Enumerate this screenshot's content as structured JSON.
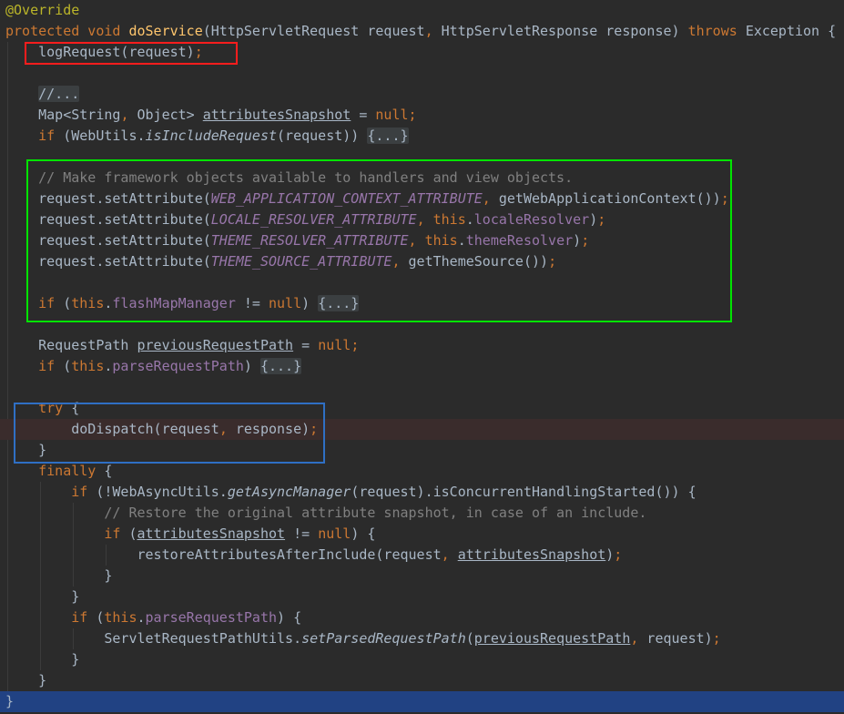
{
  "editor": {
    "lines": [
      {
        "tokens": [
          {
            "t": "@Override",
            "c": "ann"
          }
        ]
      },
      {
        "tokens": [
          {
            "t": "protected void ",
            "c": "kw"
          },
          {
            "t": "doService",
            "c": "fn"
          },
          {
            "t": "(HttpServletRequest request",
            "c": "plain"
          },
          {
            "t": ", ",
            "c": "kw"
          },
          {
            "t": "HttpServletResponse response) ",
            "c": "plain"
          },
          {
            "t": "throws ",
            "c": "kw"
          },
          {
            "t": "Exception {",
            "c": "plain"
          }
        ]
      },
      {
        "tokens": [
          {
            "t": "    logRequest(request)",
            "c": "plain"
          },
          {
            "t": ";",
            "c": "kw"
          }
        ]
      },
      {
        "tokens": []
      },
      {
        "tokens": [
          {
            "t": "    ",
            "c": "plain"
          },
          {
            "t": "//...",
            "c": "fold"
          }
        ]
      },
      {
        "tokens": [
          {
            "t": "    Map<String",
            "c": "plain"
          },
          {
            "t": ", ",
            "c": "kw"
          },
          {
            "t": "Object> ",
            "c": "plain"
          },
          {
            "t": "attributesSnapshot",
            "c": "uline"
          },
          {
            "t": " = ",
            "c": "plain"
          },
          {
            "t": "null",
            "c": "kw"
          },
          {
            "t": ";",
            "c": "kw"
          }
        ]
      },
      {
        "tokens": [
          {
            "t": "    ",
            "c": "plain"
          },
          {
            "t": "if ",
            "c": "kw"
          },
          {
            "t": "(WebUtils.",
            "c": "plain"
          },
          {
            "t": "isIncludeRequest",
            "c": "static"
          },
          {
            "t": "(request)) ",
            "c": "plain"
          },
          {
            "t": "{...}",
            "c": "fold"
          }
        ]
      },
      {
        "tokens": []
      },
      {
        "tokens": [
          {
            "t": "    // Make framework objects available to handlers and view objects.",
            "c": "comment"
          }
        ]
      },
      {
        "tokens": [
          {
            "t": "    request.setAttribute(",
            "c": "plain"
          },
          {
            "t": "WEB_APPLICATION_CONTEXT_ATTRIBUTE",
            "c": "const"
          },
          {
            "t": ", ",
            "c": "kw"
          },
          {
            "t": "getWebApplicationContext())",
            "c": "plain"
          },
          {
            "t": ";",
            "c": "kw"
          }
        ]
      },
      {
        "tokens": [
          {
            "t": "    request.setAttribute(",
            "c": "plain"
          },
          {
            "t": "LOCALE_RESOLVER_ATTRIBUTE",
            "c": "const"
          },
          {
            "t": ", ",
            "c": "kw"
          },
          {
            "t": "this",
            "c": "kw"
          },
          {
            "t": ".",
            "c": "plain"
          },
          {
            "t": "localeResolver",
            "c": "field"
          },
          {
            "t": ")",
            "c": "plain"
          },
          {
            "t": ";",
            "c": "kw"
          }
        ]
      },
      {
        "tokens": [
          {
            "t": "    request.setAttribute(",
            "c": "plain"
          },
          {
            "t": "THEME_RESOLVER_ATTRIBUTE",
            "c": "const"
          },
          {
            "t": ", ",
            "c": "kw"
          },
          {
            "t": "this",
            "c": "kw"
          },
          {
            "t": ".",
            "c": "plain"
          },
          {
            "t": "themeResolver",
            "c": "field"
          },
          {
            "t": ")",
            "c": "plain"
          },
          {
            "t": ";",
            "c": "kw"
          }
        ]
      },
      {
        "tokens": [
          {
            "t": "    request.setAttribute(",
            "c": "plain"
          },
          {
            "t": "THEME_SOURCE_ATTRIBUTE",
            "c": "const"
          },
          {
            "t": ", ",
            "c": "kw"
          },
          {
            "t": "getThemeSource())",
            "c": "plain"
          },
          {
            "t": ";",
            "c": "kw"
          }
        ]
      },
      {
        "tokens": []
      },
      {
        "tokens": [
          {
            "t": "    ",
            "c": "plain"
          },
          {
            "t": "if ",
            "c": "kw"
          },
          {
            "t": "(",
            "c": "plain"
          },
          {
            "t": "this",
            "c": "kw"
          },
          {
            "t": ".",
            "c": "plain"
          },
          {
            "t": "flashMapManager",
            "c": "field"
          },
          {
            "t": " != ",
            "c": "plain"
          },
          {
            "t": "null",
            "c": "kw"
          },
          {
            "t": ") ",
            "c": "plain"
          },
          {
            "t": "{...}",
            "c": "fold"
          }
        ]
      },
      {
        "tokens": []
      },
      {
        "tokens": [
          {
            "t": "    RequestPath ",
            "c": "plain"
          },
          {
            "t": "previousRequestPath",
            "c": "uline"
          },
          {
            "t": " = ",
            "c": "plain"
          },
          {
            "t": "null",
            "c": "kw"
          },
          {
            "t": ";",
            "c": "kw"
          }
        ]
      },
      {
        "tokens": [
          {
            "t": "    ",
            "c": "plain"
          },
          {
            "t": "if ",
            "c": "kw"
          },
          {
            "t": "(",
            "c": "plain"
          },
          {
            "t": "this",
            "c": "kw"
          },
          {
            "t": ".",
            "c": "plain"
          },
          {
            "t": "parseRequestPath",
            "c": "field"
          },
          {
            "t": ") ",
            "c": "plain"
          },
          {
            "t": "{...}",
            "c": "fold"
          }
        ]
      },
      {
        "tokens": []
      },
      {
        "tokens": [
          {
            "t": "    ",
            "c": "plain"
          },
          {
            "t": "try ",
            "c": "kw"
          },
          {
            "t": "{",
            "c": "plain"
          }
        ]
      },
      {
        "tokens": [
          {
            "t": "        doDispatch(request",
            "c": "plain"
          },
          {
            "t": ", ",
            "c": "kw"
          },
          {
            "t": "response)",
            "c": "plain"
          },
          {
            "t": ";",
            "c": "kw"
          }
        ]
      },
      {
        "tokens": [
          {
            "t": "    }",
            "c": "plain"
          }
        ]
      },
      {
        "tokens": [
          {
            "t": "    ",
            "c": "plain"
          },
          {
            "t": "finally ",
            "c": "kw"
          },
          {
            "t": "{",
            "c": "plain"
          }
        ]
      },
      {
        "tokens": [
          {
            "t": "        ",
            "c": "plain"
          },
          {
            "t": "if ",
            "c": "kw"
          },
          {
            "t": "(!WebAsyncUtils.",
            "c": "plain"
          },
          {
            "t": "getAsyncManager",
            "c": "static"
          },
          {
            "t": "(request).isConcurrentHandlingStarted()) {",
            "c": "plain"
          }
        ]
      },
      {
        "tokens": [
          {
            "t": "            // Restore the original attribute snapshot, in case of an include.",
            "c": "comment"
          }
        ]
      },
      {
        "tokens": [
          {
            "t": "            ",
            "c": "plain"
          },
          {
            "t": "if ",
            "c": "kw"
          },
          {
            "t": "(",
            "c": "plain"
          },
          {
            "t": "attributesSnapshot",
            "c": "uline"
          },
          {
            "t": " != ",
            "c": "plain"
          },
          {
            "t": "null",
            "c": "kw"
          },
          {
            "t": ") {",
            "c": "plain"
          }
        ]
      },
      {
        "tokens": [
          {
            "t": "                restoreAttributesAfterInclude(request",
            "c": "plain"
          },
          {
            "t": ", ",
            "c": "kw"
          },
          {
            "t": "attributesSnapshot",
            "c": "uline"
          },
          {
            "t": ")",
            "c": "plain"
          },
          {
            "t": ";",
            "c": "kw"
          }
        ]
      },
      {
        "tokens": [
          {
            "t": "            }",
            "c": "plain"
          }
        ]
      },
      {
        "tokens": [
          {
            "t": "        }",
            "c": "plain"
          }
        ]
      },
      {
        "tokens": [
          {
            "t": "        ",
            "c": "plain"
          },
          {
            "t": "if ",
            "c": "kw"
          },
          {
            "t": "(",
            "c": "plain"
          },
          {
            "t": "this",
            "c": "kw"
          },
          {
            "t": ".",
            "c": "plain"
          },
          {
            "t": "parseRequestPath",
            "c": "field"
          },
          {
            "t": ") {",
            "c": "plain"
          }
        ]
      },
      {
        "tokens": [
          {
            "t": "            ServletRequestPathUtils.",
            "c": "plain"
          },
          {
            "t": "setParsedRequestPath",
            "c": "static"
          },
          {
            "t": "(",
            "c": "plain"
          },
          {
            "t": "previousRequestPath",
            "c": "uline"
          },
          {
            "t": ", ",
            "c": "kw"
          },
          {
            "t": "request)",
            "c": "plain"
          },
          {
            "t": ";",
            "c": "kw"
          }
        ]
      },
      {
        "tokens": [
          {
            "t": "        }",
            "c": "plain"
          }
        ]
      },
      {
        "tokens": [
          {
            "t": "    }",
            "c": "plain"
          }
        ]
      },
      {
        "tokens": [
          {
            "t": "}",
            "c": "plain"
          }
        ]
      }
    ]
  }
}
